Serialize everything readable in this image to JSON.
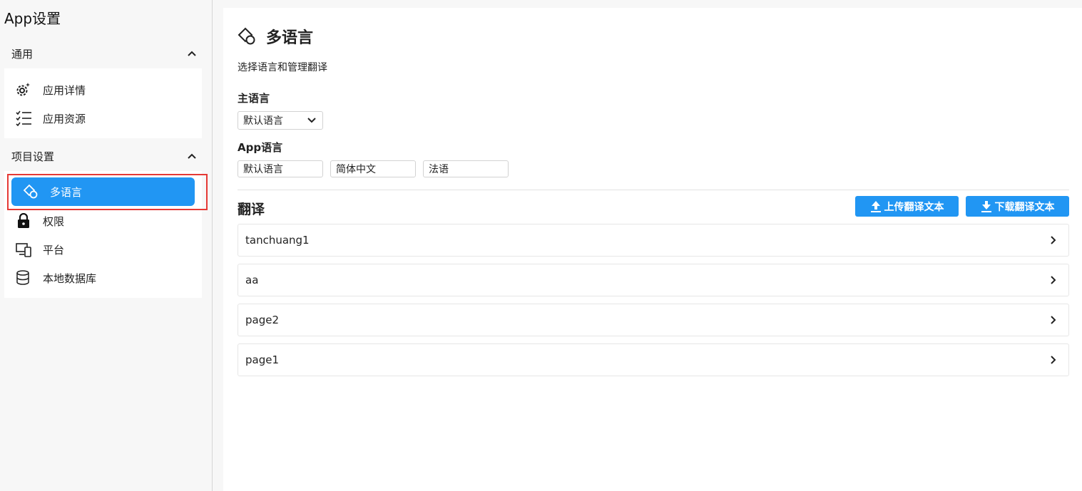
{
  "app": {
    "title": "App设置"
  },
  "sidebar": {
    "sections": [
      {
        "header": "通用",
        "items": [
          {
            "label": "应用详情",
            "icon": "gear-sparkle-icon"
          },
          {
            "label": "应用资源",
            "icon": "checklist-icon"
          }
        ]
      },
      {
        "header": "项目设置",
        "items": [
          {
            "label": "多语言",
            "icon": "translate-icon",
            "active": true
          },
          {
            "label": "权限",
            "icon": "lock-icon"
          },
          {
            "label": "平台",
            "icon": "devices-icon"
          },
          {
            "label": "本地数据库",
            "icon": "database-icon"
          }
        ]
      }
    ]
  },
  "main": {
    "title": "多语言",
    "subtitle": "选择语言和管理翻译",
    "primary_language": {
      "label": "主语言",
      "selected": "默认语言"
    },
    "app_language": {
      "label": "App语言",
      "languages": [
        "默认语言",
        "简体中文",
        "法语"
      ]
    },
    "translations": {
      "title": "翻译",
      "upload_label": "上传翻译文本",
      "download_label": "下载翻译文本",
      "items": [
        "tanchuang1",
        "aa",
        "page2",
        "page1"
      ]
    }
  },
  "colors": {
    "accent": "#2196f3",
    "highlight_outline": "#e53935"
  }
}
